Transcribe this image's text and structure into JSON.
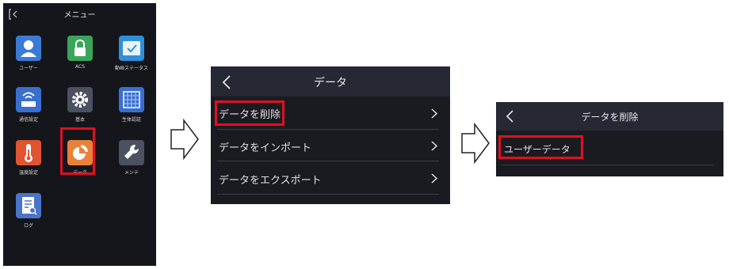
{
  "panel1": {
    "title": "メニュー",
    "tiles": [
      {
        "label": "ユーザー",
        "icon": "user-icon",
        "color": "#3a7bd5"
      },
      {
        "label": "ACS",
        "icon": "lock-icon",
        "color": "#3aa55a"
      },
      {
        "label": "動画ステータス",
        "icon": "video-status-icon",
        "color": "#2f8fd8"
      },
      {
        "label": "通信設定",
        "icon": "network-icon",
        "color": "#3a6fd0"
      },
      {
        "label": "基本",
        "icon": "gear-icon",
        "color": "#4b5160"
      },
      {
        "label": "生体認証",
        "icon": "biometric-icon",
        "color": "#3a6fd0"
      },
      {
        "label": "温度設定",
        "icon": "thermometer-icon",
        "color": "#e0542f"
      },
      {
        "label": "データ",
        "icon": "pie-chart-icon",
        "color": "#e8823a"
      },
      {
        "label": "メンテ",
        "icon": "wrench-icon",
        "color": "#4b5160"
      },
      {
        "label": "ログ",
        "icon": "log-icon",
        "color": "#4a74c9"
      }
    ]
  },
  "panel2": {
    "title": "データ",
    "items": [
      {
        "label": "データを削除"
      },
      {
        "label": "データをインポート"
      },
      {
        "label": "データをエクスポート"
      }
    ]
  },
  "panel3": {
    "title": "データを削除",
    "items": [
      {
        "label": "ユーザーデータ"
      }
    ]
  },
  "colors": {
    "highlight": "#e01020",
    "panel_bg": "#1a1b21",
    "header_bg": "#262834"
  }
}
